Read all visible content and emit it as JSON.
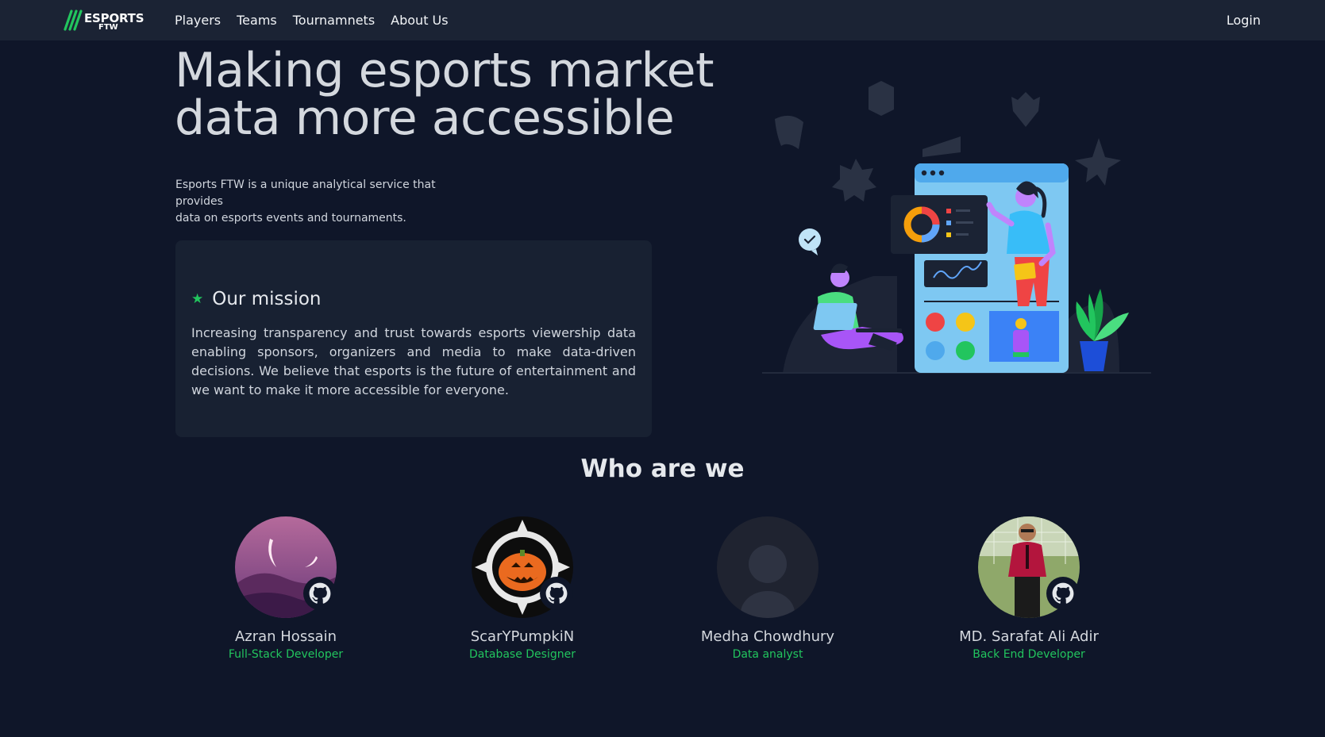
{
  "brand": {
    "logo_line1": "ESPORTS",
    "logo_line2": "FTW"
  },
  "nav": {
    "links": [
      {
        "label": "Players"
      },
      {
        "label": "Teams"
      },
      {
        "label": "Tournamnets"
      },
      {
        "label": "About Us"
      }
    ],
    "login_label": "Login"
  },
  "hero": {
    "title_line1": "Making esports market",
    "title_line2": "data more accessible",
    "subtitle_line1": "Esports FTW is a unique analytical service that provides",
    "subtitle_line2": "data on esports events and tournaments."
  },
  "mission": {
    "icon": "star-icon",
    "title": "Our mission",
    "text": "Increasing transparency and trust towards esports viewership data enabling sponsors, organizers and media to make data-driven decisions. We believe that esports is the future of entertainment and we want to make it more accessible for everyone."
  },
  "team": {
    "title": "Who are we",
    "members": [
      {
        "name": "Azran Hossain",
        "role": "Full-Stack Developer",
        "github": true
      },
      {
        "name": "ScarYPumpkiN",
        "role": "Database Designer",
        "github": true
      },
      {
        "name": "Medha Chowdhury",
        "role": "Data analyst",
        "github": false
      },
      {
        "name": "MD. Sarafat Ali Adir",
        "role": "Back End Developer",
        "github": true
      }
    ]
  },
  "colors": {
    "background": "#0f1629",
    "navbar": "#1b2334",
    "card": "#182132",
    "accent_green": "#22c55e"
  }
}
